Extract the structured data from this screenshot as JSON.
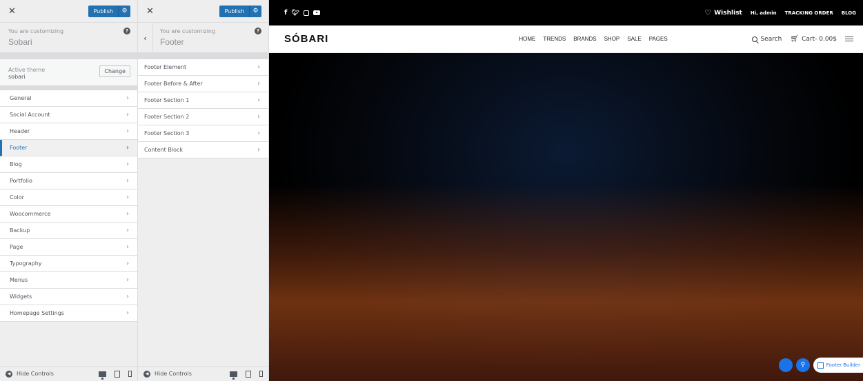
{
  "panel1": {
    "publish_label": "Publish",
    "customizing_label": "You are customizing",
    "site_name": "Sobari",
    "active_theme_label": "Active theme",
    "active_theme_value": "sobari",
    "change_label": "Change",
    "items": [
      {
        "label": "General"
      },
      {
        "label": "Social Account"
      },
      {
        "label": "Header"
      },
      {
        "label": "Footer"
      },
      {
        "label": "Blog"
      },
      {
        "label": "Portfolio"
      },
      {
        "label": "Color"
      },
      {
        "label": "Woocommerce"
      },
      {
        "label": "Backup"
      },
      {
        "label": "Page"
      },
      {
        "label": "Typography"
      },
      {
        "label": "Menus"
      },
      {
        "label": "Widgets"
      },
      {
        "label": "Homepage Settings"
      }
    ],
    "active_item": "Footer",
    "hide_controls_label": "Hide Controls"
  },
  "panel2": {
    "publish_label": "Publish",
    "customizing_label": "You are customizing",
    "section_name": "Footer",
    "items": [
      {
        "label": "Footer Element"
      },
      {
        "label": "Footer Before & After"
      },
      {
        "label": "Footer Section 1"
      },
      {
        "label": "Footer Section 2"
      },
      {
        "label": "Footer Section 3"
      },
      {
        "label": "Content Block"
      }
    ],
    "hide_controls_label": "Hide Controls"
  },
  "preview": {
    "social_icons": [
      "facebook-icon",
      "twitter-icon",
      "instagram-icon",
      "youtube-icon"
    ],
    "social_f": "f",
    "social_t": "🐦",
    "wishlist_label": "Wishlist",
    "greeting": "Hi, admin",
    "tracking_label": "TRACKING ORDER",
    "blog_label": "BLOG",
    "logo": "SÓBARI",
    "nav": [
      "HOME",
      "TRENDS",
      "BRANDS",
      "SHOP",
      "SALE",
      "PAGES"
    ],
    "search_label": "Search",
    "cart_label": "Cart- 0.00$",
    "footer_builder_label": "Footer Builder"
  },
  "colors": {
    "accent": "#2271b1",
    "panel_bg": "#eeeeee",
    "preview_topbar": "#000000",
    "fab_blue": "#1a73e8"
  }
}
